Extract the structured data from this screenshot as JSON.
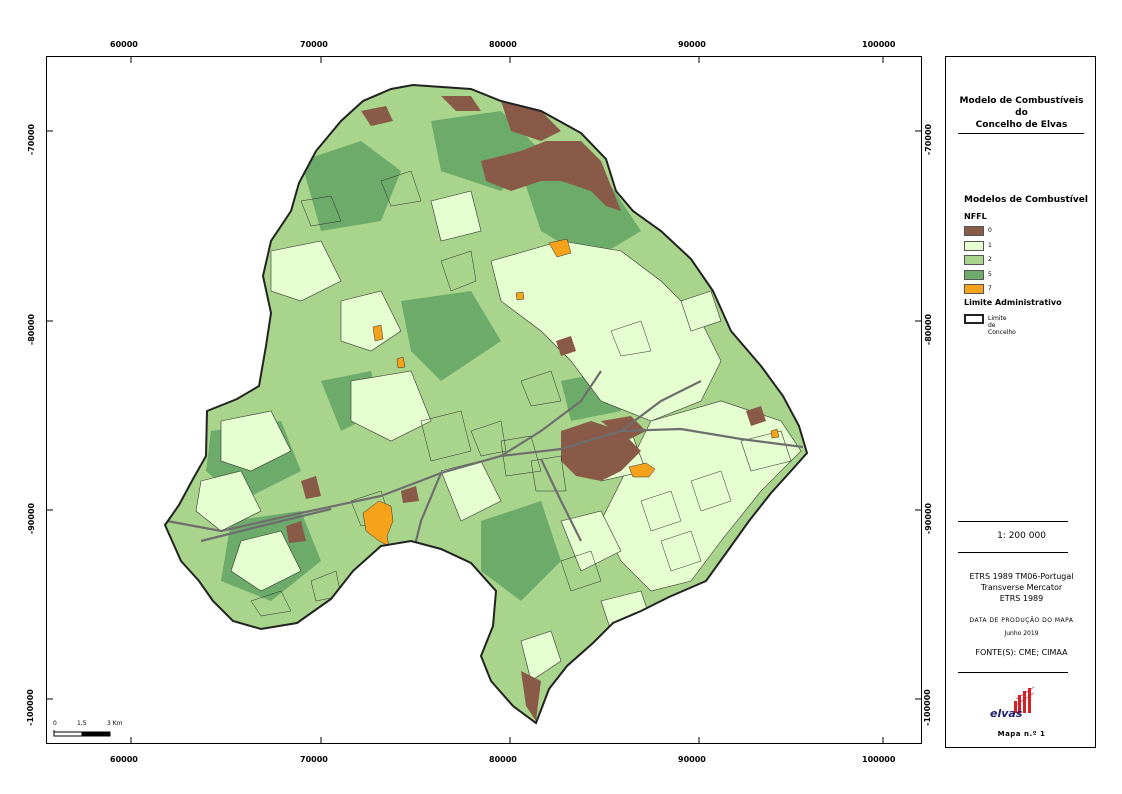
{
  "grid": {
    "x_labels": [
      "60000",
      "70000",
      "80000",
      "90000",
      "100000"
    ],
    "y_labels": [
      "-70000",
      "-80000",
      "-90000",
      "-100000"
    ]
  },
  "legend": {
    "title_lines": [
      "Modelo de Combustíveis",
      "do",
      "Concelho de Elvas"
    ],
    "section_title": "Modelos de Combustível",
    "nffl_label": "NFFL",
    "classes": [
      {
        "label": "0",
        "color": "#8a5a48"
      },
      {
        "label": "1",
        "color": "#e6ffd0"
      },
      {
        "label": "2",
        "color": "#a9d48c"
      },
      {
        "label": "5",
        "color": "#6cab6a"
      },
      {
        "label": "7",
        "color": "#f6a21a"
      }
    ],
    "admin_title": "Limite Administrativo",
    "admin_label": "Limite de Concelho",
    "scale": "1: 200 000",
    "crs_lines": [
      "ETRS 1989 TM06-Portugal",
      "Transverse Mercator",
      "ETRS 1989"
    ],
    "date_label": "DATA DE PRODUÇÃO DO MAPA",
    "date_value": "Junho 2019",
    "source": "FONTE(S): CME; CIMAA",
    "logo_text": "elvas",
    "map_number": "Mapa n.º 1"
  },
  "scalebar": {
    "labels": [
      "0",
      "1,5",
      "3 Km"
    ]
  },
  "colors": {
    "outline": "#222222",
    "roads": "#6e6e6e",
    "base": "#a9d48c"
  }
}
